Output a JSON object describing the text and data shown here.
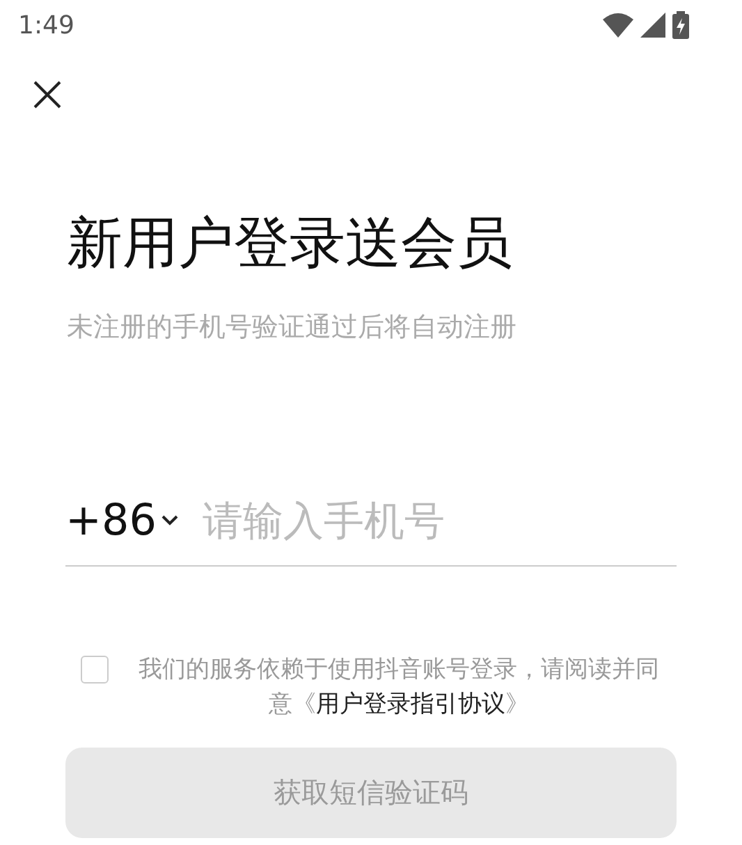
{
  "status_bar": {
    "time": "1:49"
  },
  "title": "新用户登录送会员",
  "subtitle": "未注册的手机号验证通过后将自动注册",
  "phone": {
    "country_code": "+86",
    "placeholder": "请输入手机号"
  },
  "agreement": {
    "checked": false,
    "text": "我们的服务依赖于使用抖音账号登录，请阅读并同意《",
    "link": "用户登录指引协议",
    "suffix": "》"
  },
  "submit": {
    "label": "获取短信验证码",
    "disabled": true
  }
}
